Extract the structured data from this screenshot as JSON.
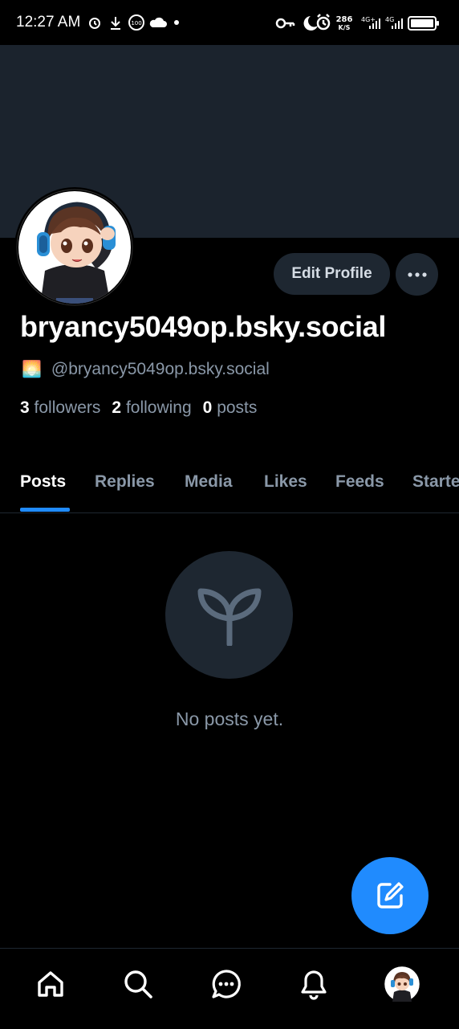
{
  "status_bar": {
    "time": "12:27 AM",
    "net_speed_value": "286",
    "net_speed_unit": "K/S",
    "network_1": "4G+",
    "network_2": "4G",
    "icons_left": [
      "alarm-clock-icon",
      "download-icon",
      "badge-100-icon",
      "cloud-icon",
      "dot-icon"
    ],
    "icons_right": [
      "key-icon",
      "moon-icon",
      "alarm-icon",
      "signal-icon",
      "signal-icon",
      "battery-icon"
    ]
  },
  "profile": {
    "display_name": "bryancy5049op.bsky.social",
    "handle": "@bryancy5049op.bsky.social",
    "handle_emoji": "🌅",
    "edit_label": "Edit Profile",
    "followers_count": "3",
    "followers_label": "followers",
    "following_count": "2",
    "following_label": "following",
    "posts_count": "0",
    "posts_label": "posts"
  },
  "tabs": [
    {
      "label": "Posts",
      "active": true
    },
    {
      "label": "Replies",
      "active": false
    },
    {
      "label": "Media",
      "active": false
    },
    {
      "label": "Likes",
      "active": false
    },
    {
      "label": "Feeds",
      "active": false
    },
    {
      "label": "Starter Packs",
      "active": false
    }
  ],
  "empty_state": {
    "icon": "sprout-icon",
    "message": "No posts yet."
  },
  "bottom_nav": [
    "home-icon",
    "search-icon",
    "chat-icon",
    "bell-icon",
    "avatar"
  ],
  "colors": {
    "background": "#000000",
    "banner": "#1b232d",
    "accent": "#208bfe",
    "muted_text": "#8a98a8",
    "button_bg": "#1e2731"
  }
}
